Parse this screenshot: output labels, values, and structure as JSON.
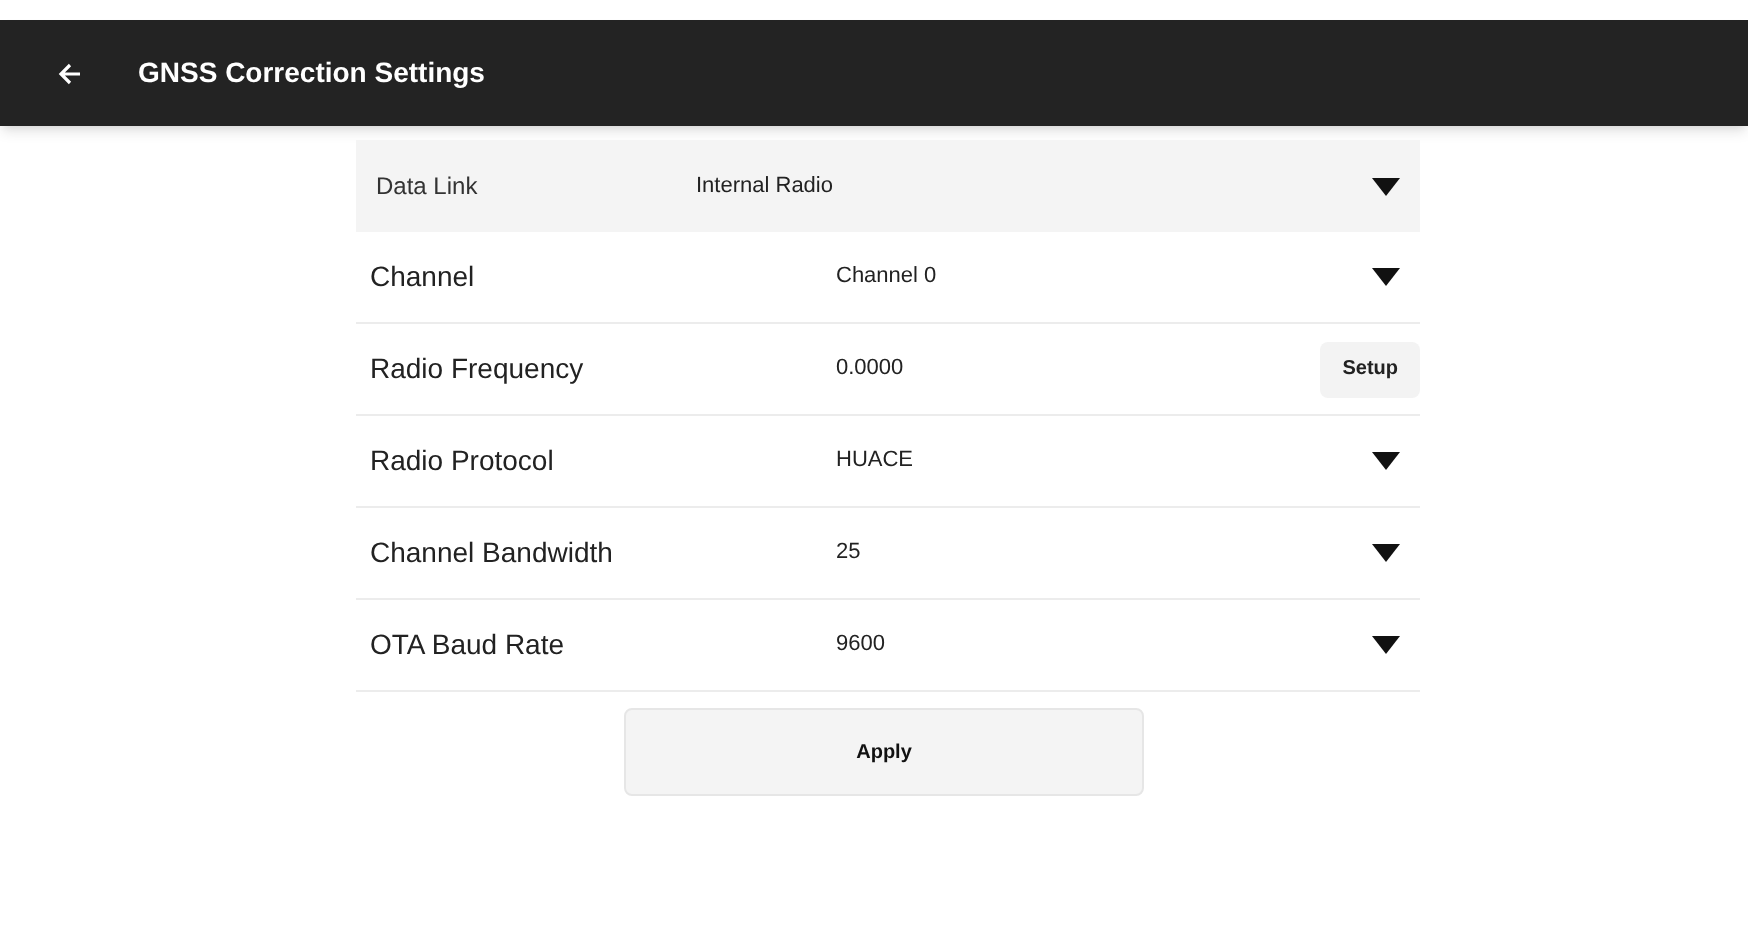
{
  "header": {
    "title": "GNSS Correction Settings"
  },
  "data_link": {
    "label": "Data Link",
    "value": "Internal Radio"
  },
  "rows": [
    {
      "label": "Channel",
      "value": "Channel 0",
      "kind": "dropdown"
    },
    {
      "label": "Radio Frequency",
      "value": "0.0000",
      "kind": "button",
      "button": "Setup"
    },
    {
      "label": "Radio Protocol",
      "value": "HUACE",
      "kind": "dropdown"
    },
    {
      "label": "Channel Bandwidth",
      "value": "25",
      "kind": "dropdown"
    },
    {
      "label": "OTA Baud Rate",
      "value": "9600",
      "kind": "dropdown"
    }
  ],
  "apply_button": "Apply"
}
